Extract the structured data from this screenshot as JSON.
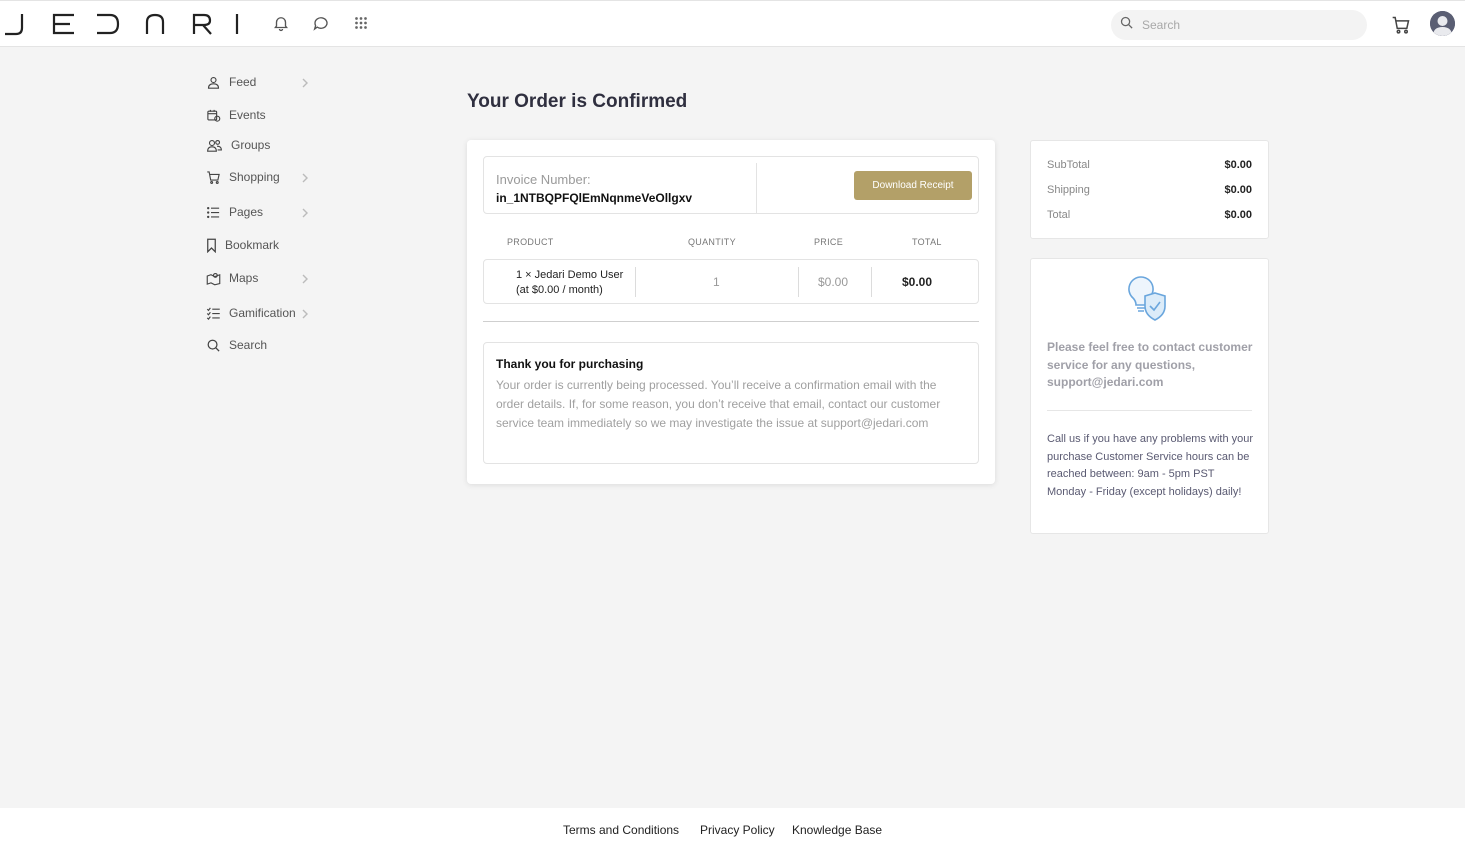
{
  "brand": {
    "logo_text": "JEDARI"
  },
  "header": {
    "search": {
      "placeholder": "Search",
      "value": ""
    },
    "icons": [
      "bell-icon",
      "chat-icon",
      "apps-grid-icon",
      "cart-icon",
      "avatar"
    ]
  },
  "sidebar": {
    "items": [
      {
        "label": "Feed",
        "icon": "user-icon",
        "has_submenu": true
      },
      {
        "label": "Events",
        "icon": "calendar-icon",
        "has_submenu": false
      },
      {
        "label": "Groups",
        "icon": "users-icon",
        "has_submenu": false
      },
      {
        "label": "Shopping",
        "icon": "cart-icon",
        "has_submenu": true
      },
      {
        "label": "Pages",
        "icon": "list-icon",
        "has_submenu": true
      },
      {
        "label": "Bookmark",
        "icon": "bookmark-icon",
        "has_submenu": false
      },
      {
        "label": "Maps",
        "icon": "map-icon",
        "has_submenu": true
      },
      {
        "label": "Gamification",
        "icon": "checklist-icon",
        "has_submenu": true
      },
      {
        "label": "Search",
        "icon": "search-icon",
        "has_submenu": false
      }
    ]
  },
  "main": {
    "title": "Your Order is Confirmed",
    "invoice": {
      "label": "Invoice Number:",
      "number": "in_1NTBQPFQlEmNqnmeVeOllgxv",
      "download_label": "Download Receipt"
    },
    "table": {
      "headers": [
        "PRODUCT",
        "QUANTITY",
        "PRICE",
        "TOTAL"
      ],
      "rows": [
        {
          "product_line1": "1 × Jedari Demo User",
          "product_line2": "(at $0.00 / month)",
          "quantity": "1",
          "price": "$0.00",
          "total": "$0.00"
        }
      ]
    },
    "thanks": {
      "title": "Thank you for purchasing",
      "text": "Your order is currently being processed. You’ll receive a confirmation email with the order details. If, for some reason, you don’t receive that email, contact our customer service team immediately so we may investigate the issue at support@jedari.com"
    }
  },
  "summary": {
    "rows": [
      {
        "label": "SubTotal",
        "value": "$0.00"
      },
      {
        "label": "Shipping",
        "value": "$0.00"
      },
      {
        "label": "Total",
        "value": "$0.00"
      }
    ]
  },
  "support": {
    "icon": "lightbulb-shield-icon",
    "contact_text": "Please feel free to contact customer service for any questions, support@jedari.com",
    "hours_text": "Call us if you have any problems with your purchase Customer Service hours can be reached between: 9am - 5pm PST Monday - Friday (except holidays) daily!"
  },
  "footer": {
    "links": [
      "Terms and Conditions",
      "Privacy Policy",
      "Knowledge Base"
    ]
  },
  "colors": {
    "accent": "#b3a068",
    "background": "#f4f4f4",
    "title": "#2f2f3f"
  }
}
